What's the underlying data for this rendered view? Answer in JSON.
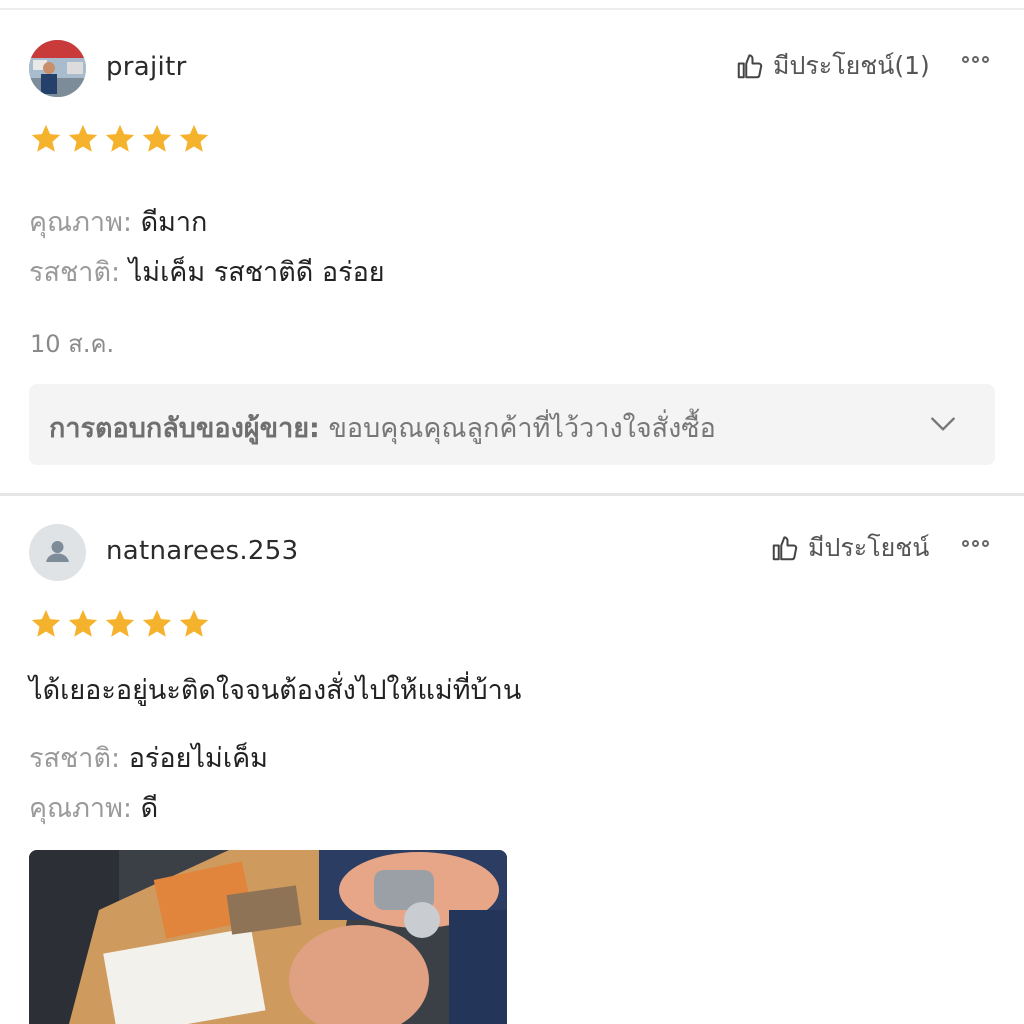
{
  "reviews": [
    {
      "username": "prajitr",
      "helpful_label": "มีประโยชน์(1)",
      "rating": 5,
      "attributes": [
        {
          "label": "คุณภาพ:",
          "value": "ดีมาก"
        },
        {
          "label": "รสชาติ:",
          "value": "ไม่เค็ม รสชาติดี อร่อย"
        }
      ],
      "date": "10 ส.ค.",
      "seller_reply": {
        "label": "การตอบกลับของผู้ขาย:",
        "text": "ขอบคุณคุณลูกค้าที่ไว้วางใจสั่งซื้อ"
      }
    },
    {
      "username": "natnarees.253",
      "helpful_label": "มีประโยชน์",
      "rating": 5,
      "text": "ได้เยอะอยู่นะติดใจจนต้องสั่งไปให้แม่ที่บ้าน",
      "attributes": [
        {
          "label": "รสชาติ:",
          "value": "อร่อยไม่เค็ม"
        },
        {
          "label": "คุณภาพ:",
          "value": "ดี"
        }
      ]
    }
  ],
  "colors": {
    "star": "#F5B22C",
    "text": "#222222",
    "muted": "#9A9A9A",
    "reply_bg": "#F4F4F4"
  },
  "icons": [
    "thumbs-up-icon",
    "more-options-icon",
    "star-icon",
    "chevron-down-icon",
    "default-avatar-icon"
  ]
}
